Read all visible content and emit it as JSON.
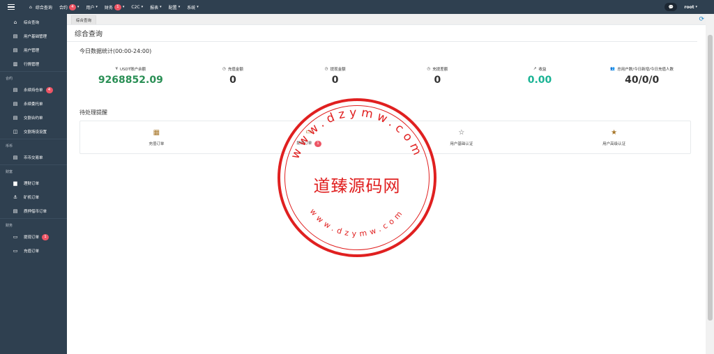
{
  "topbar": {
    "nav": [
      {
        "label": "综合查询",
        "home": true
      },
      {
        "label": "合约",
        "badge": "4",
        "caret": true
      },
      {
        "label": "用户",
        "caret": true
      },
      {
        "label": "财务",
        "badge": "1",
        "caret": true
      },
      {
        "label": "C2C",
        "caret": true
      },
      {
        "label": "报表",
        "caret": true
      },
      {
        "label": "配置",
        "caret": true
      },
      {
        "label": "系统",
        "caret": true
      }
    ],
    "user": "root"
  },
  "sidebar": {
    "items0": [
      {
        "label": "综合查询",
        "icon": "home-icon"
      },
      {
        "label": "用户基础管理",
        "icon": "file-icon"
      },
      {
        "label": "用户管理",
        "icon": "file-icon"
      },
      {
        "label": "行情管理",
        "icon": "bar-chart-icon"
      }
    ],
    "sec1": "合约",
    "items1": [
      {
        "label": "永续持仓单",
        "icon": "file-icon",
        "badge": "4"
      },
      {
        "label": "永续委托单",
        "icon": "file-icon"
      },
      {
        "label": "交割合约单",
        "icon": "file-icon"
      },
      {
        "label": "交割场设设置",
        "icon": "columns-icon"
      }
    ],
    "sec2": "币币",
    "items2": [
      {
        "label": "币币交易单",
        "icon": "file-icon"
      }
    ],
    "sec3": "财富",
    "items3": [
      {
        "label": "理财订单",
        "icon": "folder-icon"
      },
      {
        "label": "矿机订单",
        "icon": "anchor-icon"
      },
      {
        "label": "质押借币订单",
        "icon": "file-icon"
      }
    ],
    "sec4": "财务",
    "items4": [
      {
        "label": "提现订单",
        "icon": "card-icon",
        "badge": "1"
      },
      {
        "label": "充值订单",
        "icon": "card-icon"
      }
    ]
  },
  "main": {
    "tab": "综合查询",
    "title": "综合查询",
    "subtitle": "今日数据统计(00:00-24:00)",
    "stats": [
      {
        "label": "USDT账户余额",
        "value": "9268852.09",
        "prefix": "¥",
        "style": "green2"
      },
      {
        "label": "充值金额",
        "value": "0",
        "prefix": "◷"
      },
      {
        "label": "提现金额",
        "value": "0",
        "prefix": "◷"
      },
      {
        "label": "充提差额",
        "value": "0",
        "prefix": "◷"
      },
      {
        "label": "收益",
        "value": "0.00",
        "prefix": "↗",
        "style": "green"
      },
      {
        "label": "总用户数/今日新增/今日充值人数",
        "value": "40/0/0",
        "prefix": "👥"
      }
    ],
    "pending_title": "待处理提醒",
    "pending": [
      {
        "label": "充值订单",
        "icon": "qr-icon"
      },
      {
        "label": "提现订单",
        "icon": "card-icon",
        "badge": "1"
      },
      {
        "label": "用户基础认证",
        "icon": "star-outline-icon"
      },
      {
        "label": "用户高级认证",
        "icon": "star-icon"
      }
    ]
  },
  "stamp": {
    "center": "道臻源码网",
    "ring_top": "www.dzymw.com",
    "ring_bottom": "www.dzymw.com"
  },
  "colors": {
    "sidebar": "#2f4050",
    "accent_green": "#1ab394",
    "badge": "#ed5565",
    "stamp": "#e02020"
  }
}
